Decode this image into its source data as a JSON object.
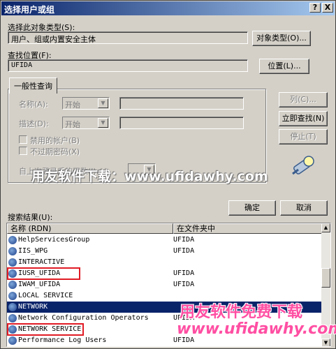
{
  "window": {
    "title": "选择用户或组",
    "help_btn": "?",
    "close_btn": "X"
  },
  "object_type": {
    "label": "选择此对象类型(S):",
    "value": "用户、组或内置安全主体",
    "button": "对象类型(O)..."
  },
  "location": {
    "label": "查找位置(F):",
    "value": "UFIDA",
    "button": "位置(L)..."
  },
  "general_query": {
    "tab": "一般性查询",
    "name_label": "名称(A):",
    "name_combo": "开始",
    "desc_label": "描述(D):",
    "desc_combo": "开始",
    "disabled_accounts": "禁用的帐户(B)",
    "non_expiring": "不过期密码(X)",
    "days_label": "自上次登录后的天数(I):"
  },
  "side_buttons": {
    "columns": "列(C)...",
    "find_now": "立即查找(N)",
    "stop": "停止(T)"
  },
  "dialog_buttons": {
    "ok": "确定",
    "cancel": "取消"
  },
  "results": {
    "label": "搜索结果(U):",
    "columns": [
      "名称 (RDN)",
      "在文件夹中"
    ],
    "rows": [
      {
        "name": "HelpServicesGroup",
        "folder": "UFIDA"
      },
      {
        "name": "IIS_WPG",
        "folder": "UFIDA"
      },
      {
        "name": "INTERACTIVE",
        "folder": ""
      },
      {
        "name": "IUSR_UFIDA",
        "folder": "UFIDA"
      },
      {
        "name": "IWAM_UFIDA",
        "folder": "UFIDA"
      },
      {
        "name": "LOCAL SERVICE",
        "folder": ""
      },
      {
        "name": "NETWORK",
        "folder": ""
      },
      {
        "name": "Network Configuration Operators",
        "folder": "UFIDA"
      },
      {
        "name": "NETWORK SERVICE",
        "folder": ""
      },
      {
        "name": "Performance Log Users",
        "folder": "UFIDA"
      }
    ]
  },
  "watermarks": {
    "middle": "用友软件下载：www.ufidawhy.com",
    "bottom_cn": "用友软件免费下载",
    "bottom_url": "www.ufidawhy.com"
  }
}
